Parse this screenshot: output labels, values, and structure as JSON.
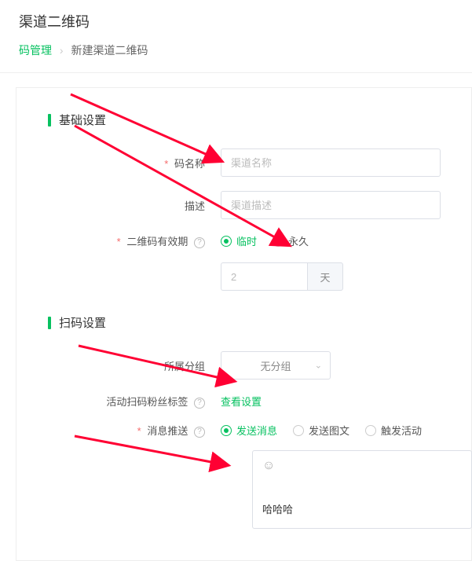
{
  "page_title": "渠道二维码",
  "breadcrumb": {
    "root_label": "码管理",
    "current_label": "新建渠道二维码"
  },
  "sections": {
    "basic": {
      "title": "基础设置"
    },
    "scan": {
      "title": "扫码设置"
    }
  },
  "fields": {
    "code_name": {
      "label": "码名称",
      "placeholder": "渠道名称"
    },
    "description": {
      "label": "描述",
      "placeholder": "渠道描述"
    },
    "validity": {
      "label": "二维码有效期",
      "option_temp": "临时",
      "option_perm": "永久",
      "days_value": "2",
      "days_unit": "天"
    },
    "group": {
      "label": "所属分组",
      "value": "无分组"
    },
    "fan_tag": {
      "label": "活动扫码粉丝标签",
      "link_text": "查看设置"
    },
    "push": {
      "label": "消息推送",
      "opt_msg": "发送消息",
      "opt_teletext": "发送图文",
      "opt_trigger": "触发活动",
      "content": "哈哈哈"
    }
  }
}
